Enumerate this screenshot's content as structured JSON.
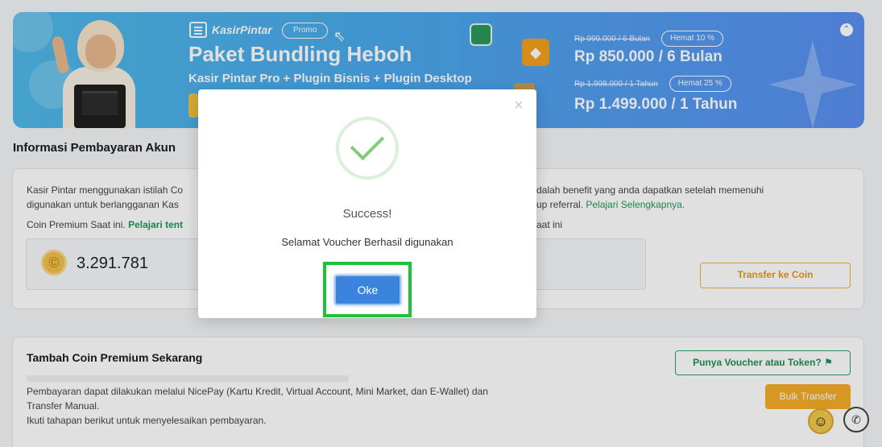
{
  "banner": {
    "brand": "KasirPintar",
    "promo_label": "Promo",
    "title": "Paket Bundling Heboh",
    "subtitle": "Kasir Pintar Pro + Plugin Bisnis + Plugin Desktop",
    "offers": [
      {
        "old_price": "Rp 999.000 / 6 Bulan",
        "discount": "Hemat 10 %",
        "new_price": "Rp 850.000 / 6 Bulan"
      },
      {
        "old_price": "Rp 1.998.000 / 1 Tahun",
        "discount": "Hemat 25 %",
        "new_price": "Rp 1.499.000 / 1 Tahun"
      }
    ]
  },
  "account_section": {
    "title": "Informasi Pembayaran Akun",
    "description_left_1": "Kasir Pintar menggunakan istilah Co",
    "description_left_2": "digunakan untuk berlangganan Kas",
    "description_right_1": "dalah benefit yang anda dapatkan setelah memenuhi",
    "description_right_2": "up referral.",
    "learn_more_link": "Pelajari Selengkapnya.",
    "coin_label": "Coin Premium Saat ini.",
    "coin_link": "Pelajari tent",
    "right_label_fragment": "aat ini",
    "coin_value": "3.291.781",
    "transfer_button": "Transfer ke Coin"
  },
  "topup_section": {
    "title": "Tambah Coin Premium Sekarang",
    "voucher_button": "Punya Voucher atau Token?",
    "paragraph_1": "Pembayaran dapat dilakukan melalui NicePay (Kartu Kredit, Virtual Account, Mini Market, dan E-Wallet) dan",
    "paragraph_2": "Transfer Manual.",
    "paragraph_3": "Ikuti tahapan berikut untuk menyelesaikan pembayaran.",
    "bulk_button": "Bulk Transfer"
  },
  "modal": {
    "title": "Success!",
    "message": "Selamat Voucher Berhasil digunakan",
    "ok_button": "Oke"
  },
  "icons": {
    "close": "close-icon",
    "success": "check-circle-icon",
    "coin": "coin-icon",
    "tag": "tag-icon",
    "whatsapp": "whatsapp-icon"
  },
  "colors": {
    "accent_green": "#20995a",
    "accent_orange": "#f4ae28",
    "modal_button": "#3a84dd",
    "highlight": "#1ec238"
  }
}
